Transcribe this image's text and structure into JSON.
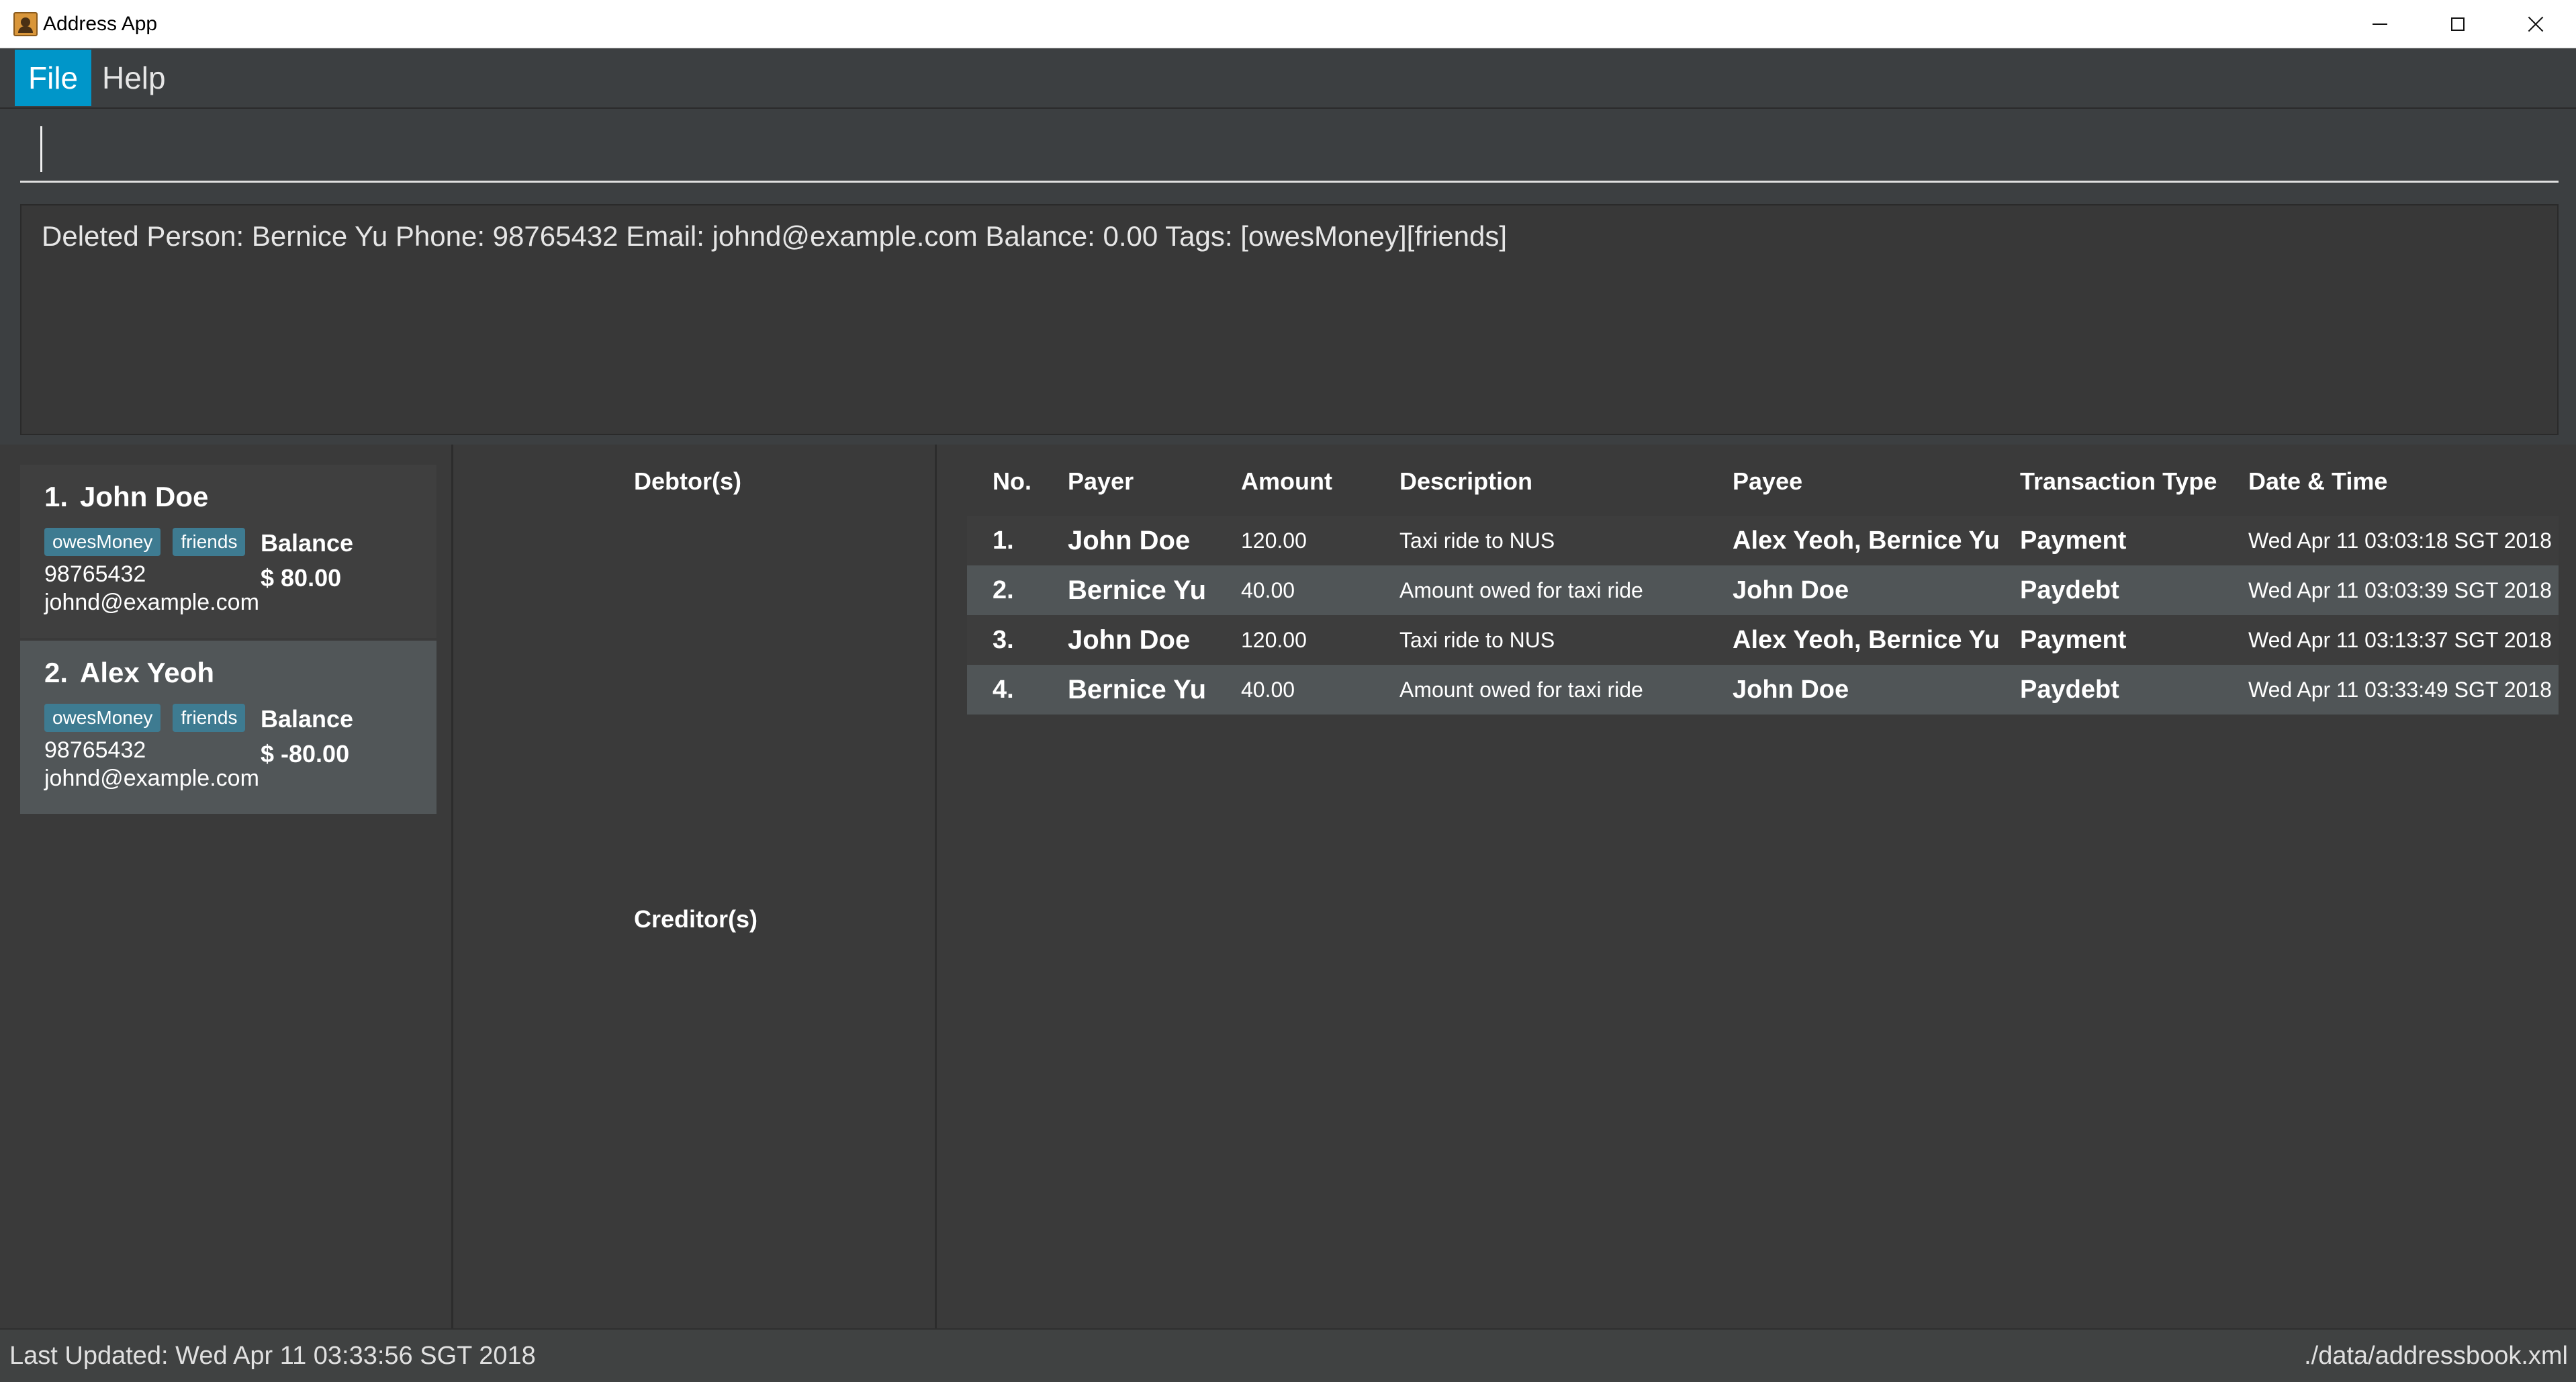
{
  "window": {
    "title": "Address App"
  },
  "menu": {
    "file": "File",
    "help": "Help"
  },
  "command_box": {
    "value": "",
    "placeholder": ""
  },
  "result_display": {
    "text": "Deleted Person: Bernice Yu Phone: 98765432 Email: johnd@example.com Balance: 0.00 Tags: [owesMoney][friends]"
  },
  "persons": [
    {
      "index": "1.",
      "name": "John Doe",
      "tags": [
        "owesMoney",
        "friends"
      ],
      "phone": "98765432",
      "email": "johnd@example.com",
      "balance_label": "Balance",
      "balance": "$ 80.00"
    },
    {
      "index": "2.",
      "name": "Alex Yeoh",
      "tags": [
        "owesMoney",
        "friends"
      ],
      "phone": "98765432",
      "email": "johnd@example.com",
      "balance_label": "Balance",
      "balance": "$ -80.00"
    }
  ],
  "debtors_header": "Debtor(s)",
  "creditors_header": "Creditor(s)",
  "transactions": {
    "columns": {
      "no": "No.",
      "payer": "Payer",
      "amount": "Amount",
      "description": "Description",
      "payee": "Payee",
      "type": "Transaction Type",
      "date": "Date & Time"
    },
    "rows": [
      {
        "no": "1.",
        "payer": "John Doe",
        "amount": "120.00",
        "description": "Taxi ride to NUS",
        "payee": "Alex Yeoh, Bernice Yu",
        "type": "Payment",
        "date": "Wed Apr 11 03:03:18 SGT 2018"
      },
      {
        "no": "2.",
        "payer": "Bernice Yu",
        "amount": "40.00",
        "description": "Amount owed for taxi ride",
        "payee": "John Doe",
        "type": "Paydebt",
        "date": "Wed Apr 11 03:03:39 SGT 2018"
      },
      {
        "no": "3.",
        "payer": "John Doe",
        "amount": "120.00",
        "description": "Taxi ride to NUS",
        "payee": "Alex Yeoh, Bernice Yu",
        "type": "Payment",
        "date": "Wed Apr 11 03:13:37 SGT 2018"
      },
      {
        "no": "4.",
        "payer": "Bernice Yu",
        "amount": "40.00",
        "description": "Amount owed for taxi ride",
        "payee": "John Doe",
        "type": "Paydebt",
        "date": "Wed Apr 11 03:33:49 SGT 2018"
      }
    ]
  },
  "status": {
    "last_updated": "Last Updated: Wed Apr 11 03:33:56 SGT 2018",
    "file_path": "./data/addressbook.xml"
  },
  "colors": {
    "menu_active": "#0096c9",
    "tag": "#3e7b91",
    "selected_row": "#505557",
    "background": "#3c3f41"
  },
  "icons": {
    "app": "address-book-icon",
    "minimize": "minimize-icon",
    "maximize": "maximize-icon",
    "close": "close-icon"
  }
}
